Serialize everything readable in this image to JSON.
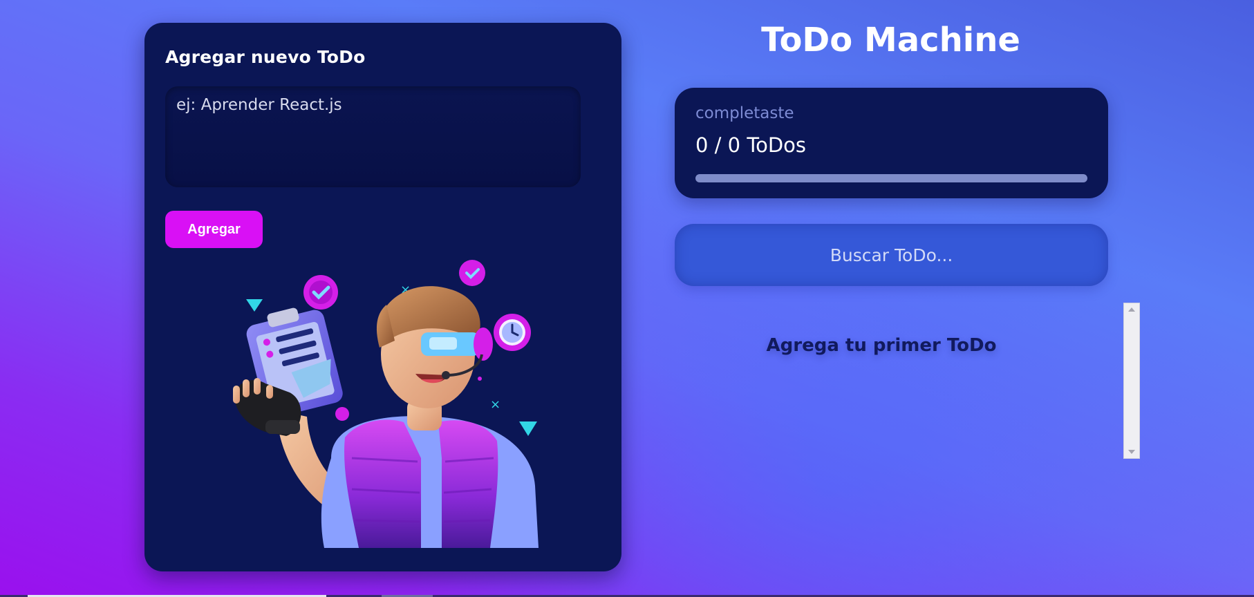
{
  "create_card": {
    "title": "Agregar nuevo ToDo",
    "textarea_placeholder": "ej: Aprender React.js",
    "textarea_value": "",
    "add_button_label": "Agregar",
    "illustration_icon": "developer-avatar-illustration"
  },
  "app": {
    "title": "ToDo Machine"
  },
  "counter": {
    "caption": "completaste",
    "value_text": "0 / 0 ToDos",
    "completed": 0,
    "total": 0,
    "progress_fraction": 0
  },
  "search": {
    "placeholder": "Buscar ToDo...",
    "value": ""
  },
  "todo_list": {
    "empty_message": "Agrega tu primer ToDo",
    "items": []
  },
  "colors": {
    "card_background": "#0b1655",
    "accent": "#d910f5",
    "search_background": "#3558d8",
    "empty_message": "#111a5e",
    "progress_track": "#7f8cc9"
  },
  "icons": {
    "scroll_up": "triangle-up-icon",
    "scroll_down": "triangle-down-icon"
  }
}
